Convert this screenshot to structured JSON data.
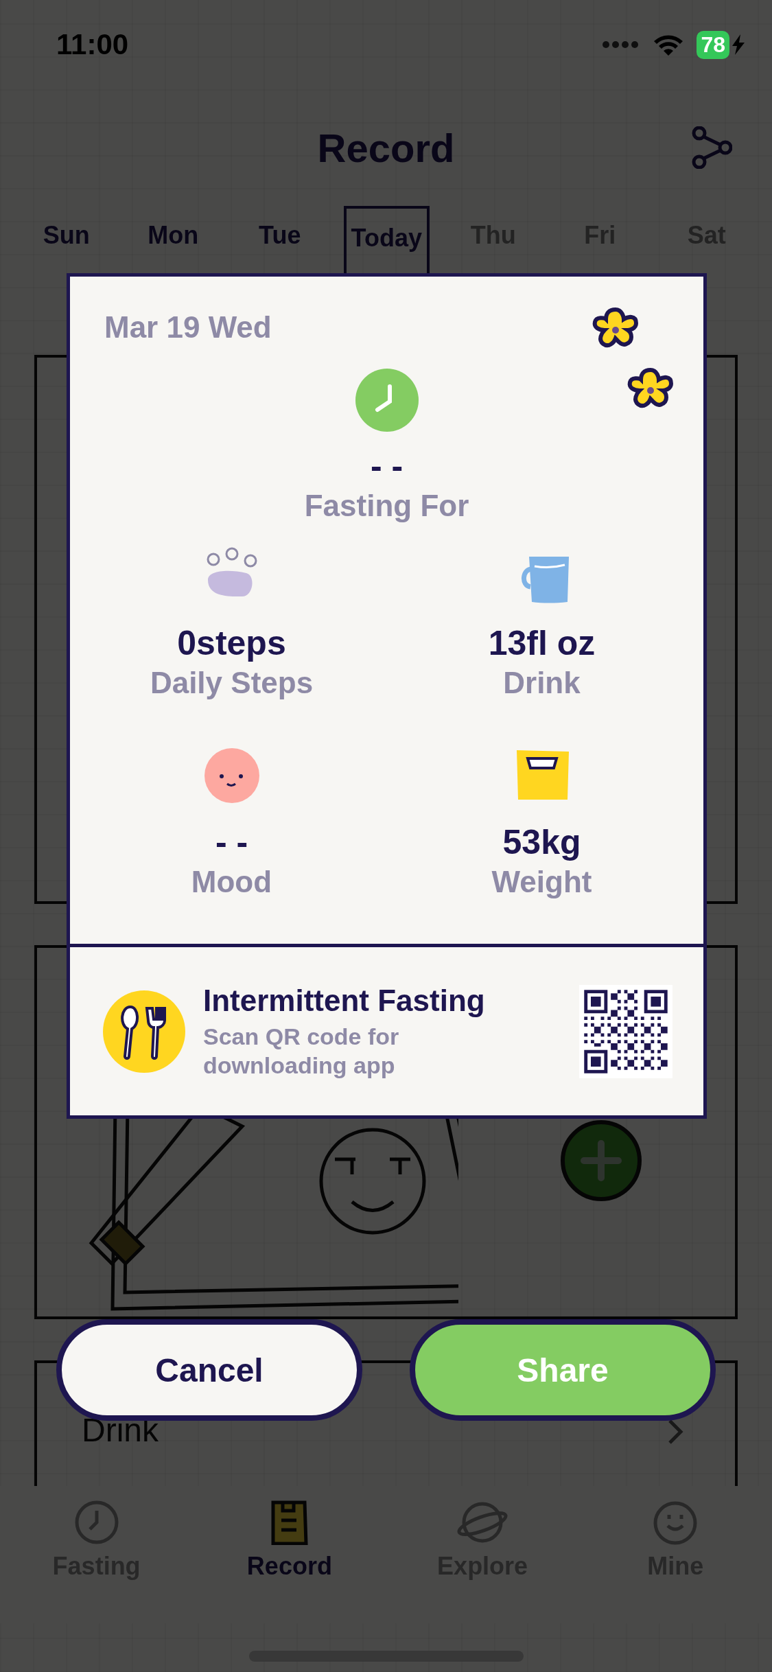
{
  "status_bar": {
    "time": "11:00",
    "battery": "78"
  },
  "header": {
    "title": "Record"
  },
  "week": [
    {
      "day": "Sun",
      "selected": false,
      "future": false
    },
    {
      "day": "Mon",
      "selected": false,
      "future": false
    },
    {
      "day": "Tue",
      "selected": false,
      "future": false
    },
    {
      "day": "Today",
      "selected": true,
      "future": false
    },
    {
      "day": "Thu",
      "selected": false,
      "future": true
    },
    {
      "day": "Fri",
      "selected": false,
      "future": true
    },
    {
      "day": "Sat",
      "selected": false,
      "future": true
    }
  ],
  "drink_section": {
    "title": "Drink"
  },
  "share_card": {
    "date": "Mar 19 Wed",
    "fasting": {
      "value": "- -",
      "label": "Fasting For"
    },
    "stats": [
      {
        "kind": "steps",
        "value": "0steps",
        "label": "Daily Steps"
      },
      {
        "kind": "drink",
        "value": "13fl oz",
        "label": "Drink"
      },
      {
        "kind": "mood",
        "value": "- -",
        "label": "Mood"
      },
      {
        "kind": "weight",
        "value": "53kg",
        "label": "Weight"
      }
    ],
    "promo": {
      "title": "Intermittent Fasting",
      "subtitle": "Scan QR code for downloading app"
    }
  },
  "buttons": [
    {
      "kind": "cancel",
      "label": "Cancel"
    },
    {
      "kind": "share",
      "label": "Share"
    }
  ],
  "tab_bar": [
    {
      "kind": "fasting",
      "label": "Fasting",
      "selected": false
    },
    {
      "kind": "record",
      "label": "Record",
      "selected": true
    },
    {
      "kind": "explore",
      "label": "Explore",
      "selected": false
    },
    {
      "kind": "mine",
      "label": "Mine",
      "selected": false
    }
  ]
}
